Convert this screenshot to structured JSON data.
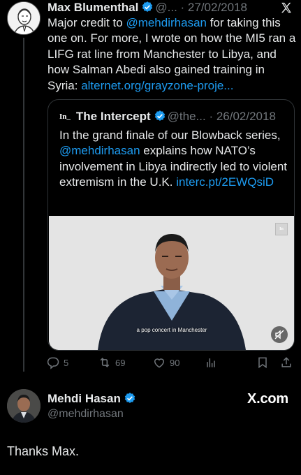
{
  "tweet": {
    "author_name": "Max Blumenthal",
    "handle": "@...",
    "separator": " · ",
    "date": "27/02/2018",
    "text_before": "Major credit to ",
    "mention": "@mehdirhasan",
    "text_after": " for taking this one on. For more, I wrote on how the MI5 ran a LIFG rat line from Manchester to Libya, and how Salman Abedi also gained training in Syria: ",
    "link": "alternet.org/grayzone-proje...",
    "quote": {
      "logo": "In_",
      "author_name": "The Intercept",
      "handle": "@the...",
      "separator": " · ",
      "date": "26/02/2018",
      "text_before": "In the grand finale of our Blowback series, ",
      "mention": "@mehdirhasan",
      "text_after": " explains how NATO’s involvement in Libya indirectly led to violent extremism in the U.K. ",
      "link": "interc.pt/2EWQsiD",
      "video_caption": "a pop concert in Manchester",
      "watermark": "In"
    },
    "actions": {
      "replies": "5",
      "retweets": "69",
      "likes": "90"
    }
  },
  "reply": {
    "author_name": "Mehdi Hasan",
    "handle": "@mehdirhasan",
    "brand": "X.com",
    "text": "Thanks Max."
  },
  "colors": {
    "background": "#000000",
    "text": "#e7e9ea",
    "muted": "#71767b",
    "link": "#1d9bf0",
    "verified": "#1d9bf0"
  },
  "icons": [
    "x-logo-icon",
    "verified-badge-icon",
    "reply-icon",
    "retweet-icon",
    "like-icon",
    "views-icon",
    "bookmark-icon",
    "share-icon",
    "mute-icon"
  ]
}
